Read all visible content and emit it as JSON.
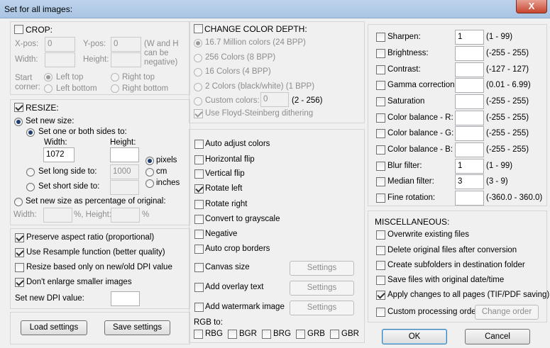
{
  "window": {
    "title": "Set for all images:",
    "close_glyph": "X"
  },
  "crop": {
    "title": "CROP:",
    "xpos_label": "X-pos:",
    "xpos_value": "0",
    "ypos_label": "Y-pos:",
    "ypos_value": "0",
    "width_label": "Width:",
    "height_label": "Height:",
    "note": [
      "(W and H",
      "can be",
      "negative)"
    ],
    "start_corner_label": [
      "Start",
      "corner:"
    ],
    "corners": [
      "Left top",
      "Right top",
      "Left bottom",
      "Right bottom"
    ]
  },
  "resize": {
    "title": "RESIZE:",
    "set_new_size": "Set new size:",
    "set_one_or_both": "Set one or both sides to:",
    "width_label": "Width:",
    "height_label": "Height:",
    "width_value": "1072",
    "units": [
      "pixels",
      "cm",
      "inches"
    ],
    "long_side": "Set long side to:",
    "long_side_value": "1000",
    "short_side": "Set short side to:",
    "percentage": "Set new size as percentage of original:",
    "pct_width": "Width:",
    "pct_percent": "%, Height:",
    "pct_percent2": "%"
  },
  "options": {
    "preserve": "Preserve aspect ratio (proportional)",
    "resample": "Use Resample function (better quality)",
    "dpi_based": "Resize based only on new/old DPI value",
    "dont_enlarge": "Don't enlarge smaller images",
    "set_dpi": "Set new DPI value:"
  },
  "buttons": {
    "load": "Load settings",
    "save": "Save settings",
    "ok": "OK",
    "cancel": "Cancel",
    "settings": "Settings",
    "change_order": "Change order"
  },
  "color_depth": {
    "title": "CHANGE COLOR DEPTH:",
    "items": [
      "16.7 Million colors (24 BPP)",
      "256 Colors (8 BPP)",
      "16 Colors (4 BPP)",
      "2 Colors (black/white) (1 BPP)"
    ],
    "custom": "Custom colors:",
    "custom_value": "0",
    "custom_range": "(2 - 256)",
    "dithering": "Use Floyd-Steinberg dithering"
  },
  "adjust": {
    "items": [
      "Auto adjust colors",
      "Horizontal flip",
      "Vertical flip",
      "Rotate left",
      "Rotate right",
      "Convert to grayscale",
      "Negative",
      "Auto crop borders"
    ],
    "canvas": "Canvas size",
    "overlay": "Add overlay text",
    "watermark": "Add watermark image",
    "rgb_label": "RGB to:",
    "rgb": [
      "RBG",
      "BGR",
      "BRG",
      "GRB",
      "GBR"
    ]
  },
  "filters": [
    {
      "label": "Sharpen:",
      "value": "1",
      "range": "(1 - 99)"
    },
    {
      "label": "Brightness:",
      "value": "",
      "range": "(-255 - 255)"
    },
    {
      "label": "Contrast:",
      "value": "",
      "range": "(-127 - 127)"
    },
    {
      "label": "Gamma correction:",
      "value": "",
      "range": "(0.01 - 6.99)"
    },
    {
      "label": "Saturation",
      "value": "",
      "range": "(-255 - 255)"
    },
    {
      "label": "Color balance - R:",
      "value": "",
      "range": "(-255 - 255)"
    },
    {
      "label": "Color balance - G:",
      "value": "",
      "range": "(-255 - 255)"
    },
    {
      "label": "Color balance - B:",
      "value": "",
      "range": "(-255 - 255)"
    },
    {
      "label": "Blur filter:",
      "value": "1",
      "range": "(1 - 99)"
    },
    {
      "label": "Median filter:",
      "value": "3",
      "range": "(3 - 9)"
    },
    {
      "label": "Fine rotation:",
      "value": "",
      "range": "(-360.0 - 360.0)"
    }
  ],
  "misc": {
    "title": "MISCELLANEOUS:",
    "items": [
      "Overwrite existing files",
      "Delete original files after conversion",
      "Create subfolders in destination folder",
      "Save files with original date/time",
      "Apply changes to all pages (TIF/PDF saving)",
      "Custom processing order"
    ]
  }
}
